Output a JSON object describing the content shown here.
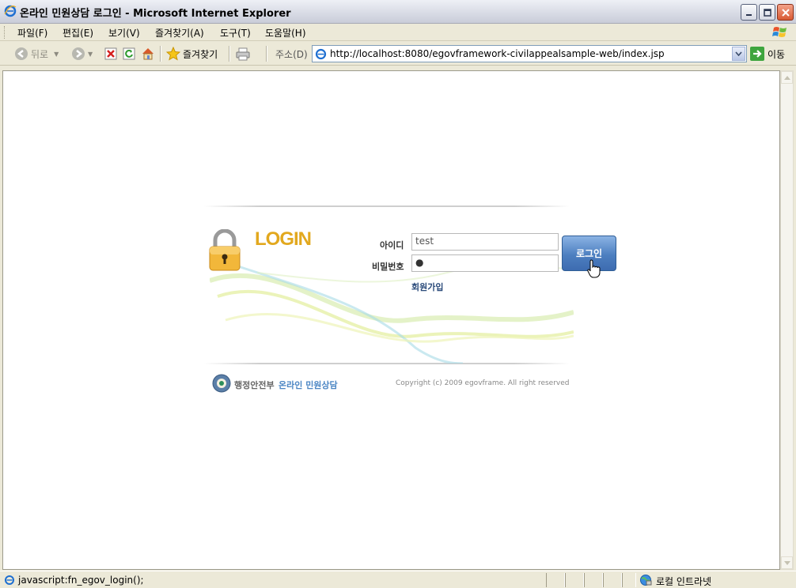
{
  "window": {
    "title": "온라인 민원상담 로그인 - Microsoft Internet Explorer"
  },
  "menu": {
    "items": [
      "파일(F)",
      "편집(E)",
      "보기(V)",
      "즐겨찾기(A)",
      "도구(T)",
      "도움말(H)"
    ]
  },
  "toolbar": {
    "back_label": "뒤로",
    "favorites_label": "즐겨찾기",
    "address_label": "주소(D)",
    "address_value": "http://localhost:8080/egovframework-civilappealsample-web/index.jsp",
    "go_label": "이동"
  },
  "login": {
    "title": "LOGIN",
    "id_label": "아이디",
    "id_value": "test",
    "password_label": "비밀번호",
    "password_value": "●",
    "login_button": "로그인",
    "join_link": "회원가입"
  },
  "footer": {
    "ministry": "행정안전부",
    "service": "온라인 민원상담",
    "copyright": "Copyright (c) 2009 egovframe. All right reserved"
  },
  "statusbar": {
    "text": "javascript:fn_egov_login();",
    "zone": "로컬 인트라넷"
  },
  "colors": {
    "login_title": "#e2a81e",
    "login_button": "#4d7fc0",
    "join_link": "#2a4a7a",
    "service_text": "#4b86c4"
  }
}
